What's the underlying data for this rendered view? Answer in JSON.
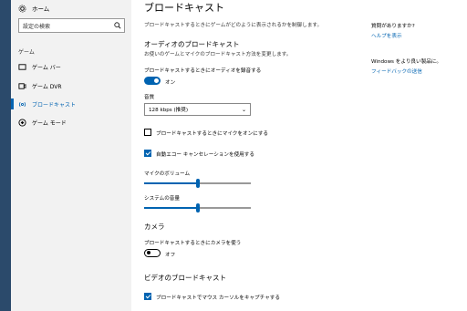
{
  "sidebar": {
    "home_label": "ホーム",
    "search_placeholder": "設定の検索",
    "section_label": "ゲーム",
    "items": [
      {
        "label": "ゲーム バー",
        "icon": "game-bar-icon"
      },
      {
        "label": "ゲーム DVR",
        "icon": "game-dvr-icon"
      },
      {
        "label": "ブロードキャスト",
        "icon": "broadcast-icon",
        "selected": true
      },
      {
        "label": "ゲーム モード",
        "icon": "game-mode-icon"
      }
    ]
  },
  "main": {
    "title": "ブロードキャスト",
    "description": "ブロードキャストするときにゲームがどのように表示されるかを制御します。",
    "audio": {
      "heading": "オーディオのブロードキャスト",
      "description": "お使いのゲームとマイクのブロードキャスト方法を変更します。",
      "echo_label": "ブロードキャストするときにオーディオを録音する",
      "echo_toggle_state": "オン",
      "quality_label": "音質",
      "quality_value": "128 kbps (推奨)",
      "mic_on_label": "ブロードキャストするときにマイクをオンにする",
      "mic_on_checked": false,
      "echo_cancel_label": "自動エコー キャンセレーションを使用する",
      "echo_cancel_checked": true,
      "mic_volume_label": "マイクのボリューム",
      "mic_volume_value": 0.5,
      "system_volume_label": "システムの音量",
      "system_volume_value": 0.5
    },
    "camera": {
      "heading": "カメラ",
      "toggle_label": "ブロードキャストするときにカメラを使う",
      "toggle_state": "オフ"
    },
    "video": {
      "heading": "ビデオのブロードキャスト",
      "cursor_label": "ブロードキャストでマウス カーソルをキャプチャする",
      "cursor_checked": true
    }
  },
  "right_panel": {
    "question": "質問がありますか?",
    "help_link": "ヘルプを表示",
    "improve_text": "Windows をより良い製品に。",
    "feedback_link": "フィードバックの送信"
  },
  "colors": {
    "accent": "#0063b1",
    "sidebar_bg": "#f2f2f2",
    "taskbar": "#2b4a6b"
  }
}
